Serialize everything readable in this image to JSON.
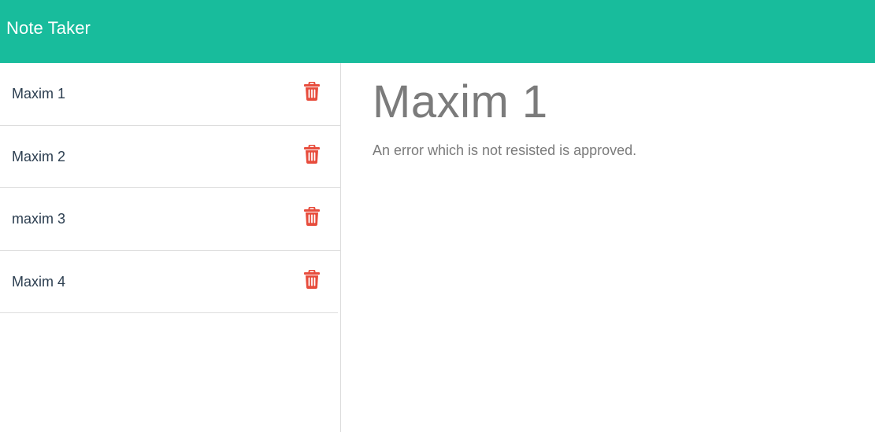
{
  "navbar": {
    "brand": "Note Taker"
  },
  "sidebar": {
    "notes": [
      {
        "title": "Maxim 1",
        "delete_icon": "trash-icon"
      },
      {
        "title": "Maxim 2",
        "delete_icon": "trash-icon"
      },
      {
        "title": "maxim 3",
        "delete_icon": "trash-icon"
      },
      {
        "title": "Maxim 4",
        "delete_icon": "trash-icon"
      }
    ]
  },
  "main": {
    "title": "Maxim 1",
    "text": "An error which is not resisted is approved."
  },
  "colors": {
    "navbar": "#18bc9c",
    "delete_icon": "#e74c3c",
    "note_title_text": "#2c3e50",
    "content_text": "#7b7b7b"
  }
}
